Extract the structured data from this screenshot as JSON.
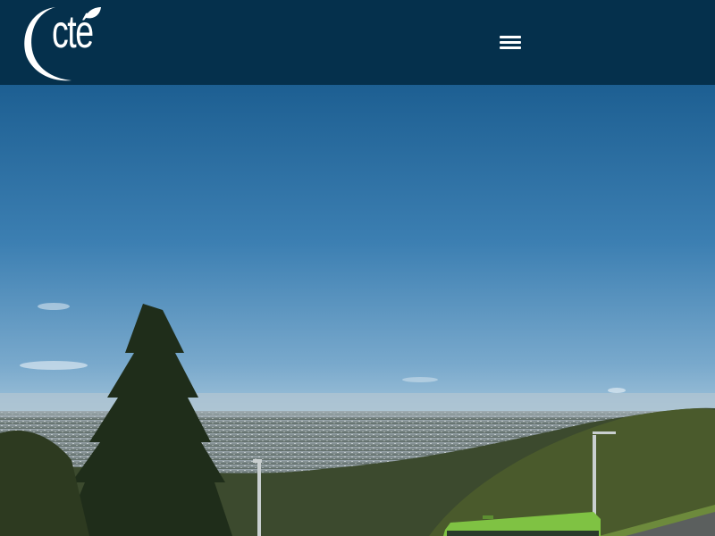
{
  "header": {
    "logo_text": "cté",
    "logo_icon": "leaf-crescent-logo",
    "menu_icon": "hamburger-menu-icon",
    "background_color": "#05304c"
  },
  "hero": {
    "image_subject": "hillside-city-overlook-with-trees-and-bus",
    "sky_color_top": "#1d5f92",
    "sky_color_horizon": "#a9c8dc"
  }
}
